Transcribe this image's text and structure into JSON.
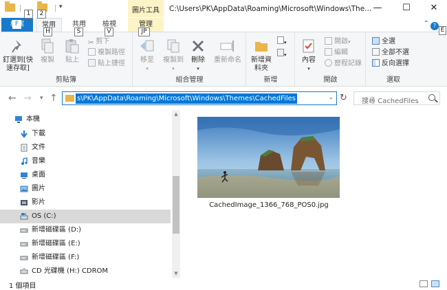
{
  "window": {
    "title": "C:\\Users\\PK\\AppData\\Roaming\\Microsoft\\Windows\\The...",
    "context_tab_title": "圖片工具",
    "minimize_glyph": "—",
    "maximize_glyph": "☐",
    "close_glyph": "✕"
  },
  "quick_access": {
    "keytips": [
      "1",
      "2"
    ],
    "dropdown_glyph": "▾"
  },
  "tabs": {
    "file_label": "檔案",
    "file_keytip": "F",
    "items": [
      {
        "label": "常用",
        "keytip": "H"
      },
      {
        "label": "共用",
        "keytip": "S"
      },
      {
        "label": "檢視",
        "keytip": "V"
      },
      {
        "label": "管理",
        "keytip": "JP"
      }
    ],
    "collapse_glyph": "⌃",
    "help_glyph": "?",
    "help_keytip": "E"
  },
  "ribbon": {
    "clipboard": {
      "label": "剪貼簿",
      "pin_label": "釘選到[快速存取]",
      "copy_label": "複製",
      "paste_label": "貼上",
      "cut_label": "剪下",
      "copy_path_label": "複製路徑",
      "paste_shortcut_label": "貼上捷徑"
    },
    "organize": {
      "label": "組合管理",
      "move_label": "移至",
      "copyto_label": "複製到",
      "delete_label": "刪除",
      "rename_label": "重新命名"
    },
    "new": {
      "label": "新增",
      "new_folder_label": "新增資料夾"
    },
    "open": {
      "label": "開啟",
      "properties_label": "內容",
      "open_label": "開啟",
      "edit_label": "編輯",
      "history_label": "歷程記錄"
    },
    "select": {
      "label": "選取",
      "select_all_label": "全選",
      "select_none_label": "全部不選",
      "invert_label": "反向選擇"
    }
  },
  "addressbar": {
    "back_glyph": "←",
    "forward_glyph": "→",
    "recent_glyph": "▾",
    "up_glyph": "↑",
    "path": "s\\PK\\AppData\\Roaming\\Microsoft\\Windows\\Themes\\CachedFiles",
    "dropdown_glyph": "⌄",
    "refresh_glyph": "↻",
    "search_placeholder": "搜尋 CachedFiles"
  },
  "navpane": {
    "items": [
      {
        "label": "本機",
        "icon": "computer-icon"
      },
      {
        "label": "下載",
        "icon": "downloads-icon"
      },
      {
        "label": "文件",
        "icon": "documents-icon"
      },
      {
        "label": "音樂",
        "icon": "music-icon"
      },
      {
        "label": "桌面",
        "icon": "desktop-icon"
      },
      {
        "label": "圖片",
        "icon": "pictures-icon"
      },
      {
        "label": "影片",
        "icon": "videos-icon"
      },
      {
        "label": "OS (C:)",
        "icon": "drive-c-icon",
        "selected": true
      },
      {
        "label": "新增磁碟區 (D:)",
        "icon": "drive-icon"
      },
      {
        "label": "新增磁碟區 (E:)",
        "icon": "drive-icon"
      },
      {
        "label": "新增磁碟區 (F:)",
        "icon": "drive-icon"
      },
      {
        "label": "CD 光碟機 (H:) CDROM",
        "icon": "cdrom-icon"
      }
    ]
  },
  "content": {
    "file_name": "CachedImage_1366_768_POS0.jpg"
  },
  "status": {
    "item_count": "1 個項目"
  },
  "colors": {
    "accent": "#1979ca",
    "selection": "#0078d7",
    "context_tab": "#fcf3c6",
    "folder": "#e9b649"
  }
}
